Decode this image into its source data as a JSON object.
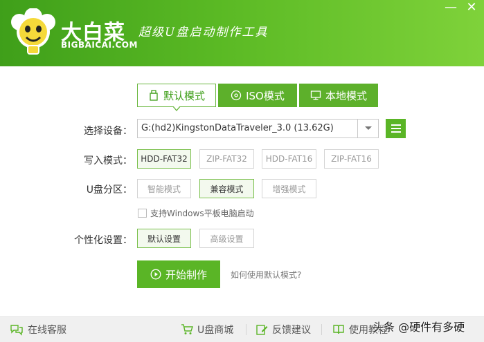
{
  "header": {
    "brand_name": "大白菜",
    "brand_url": "BIGBAICAI.COM",
    "slogan": "超级U盘启动制作工具",
    "minimize": "—",
    "close": "✕"
  },
  "tabs": [
    {
      "label": "默认模式",
      "icon": "usb-icon"
    },
    {
      "label": "ISO模式",
      "icon": "disc-icon"
    },
    {
      "label": "本地模式",
      "icon": "monitor-icon"
    }
  ],
  "device": {
    "label": "选择设备：",
    "value": "G:(hd2)KingstonDataTraveler_3.0 (13.62G)"
  },
  "write_mode": {
    "label": "写入模式：",
    "options": [
      "HDD-FAT32",
      "ZIP-FAT32",
      "HDD-FAT16",
      "ZIP-FAT16"
    ],
    "selected": "HDD-FAT32"
  },
  "partition": {
    "label": "U盘分区：",
    "options": [
      "智能模式",
      "兼容模式",
      "增强模式"
    ],
    "selected": "兼容模式"
  },
  "tablet_checkbox": {
    "label": "支持Windows平板电脑启动",
    "checked": false
  },
  "personalize": {
    "label": "个性化设置：",
    "options": [
      "默认设置",
      "高级设置"
    ],
    "selected": "默认设置"
  },
  "start_button": "开始制作",
  "help_link": "如何使用默认模式?",
  "footer": {
    "support": "在线客服",
    "shop": "U盘商城",
    "feedback": "反馈建议",
    "tutorial": "使用教程"
  },
  "watermark": "头条 @硬件有多硬",
  "colors": {
    "brand_green": "#5ab526",
    "header_dark": "#3f9f1a",
    "header_light": "#7fd23a"
  }
}
